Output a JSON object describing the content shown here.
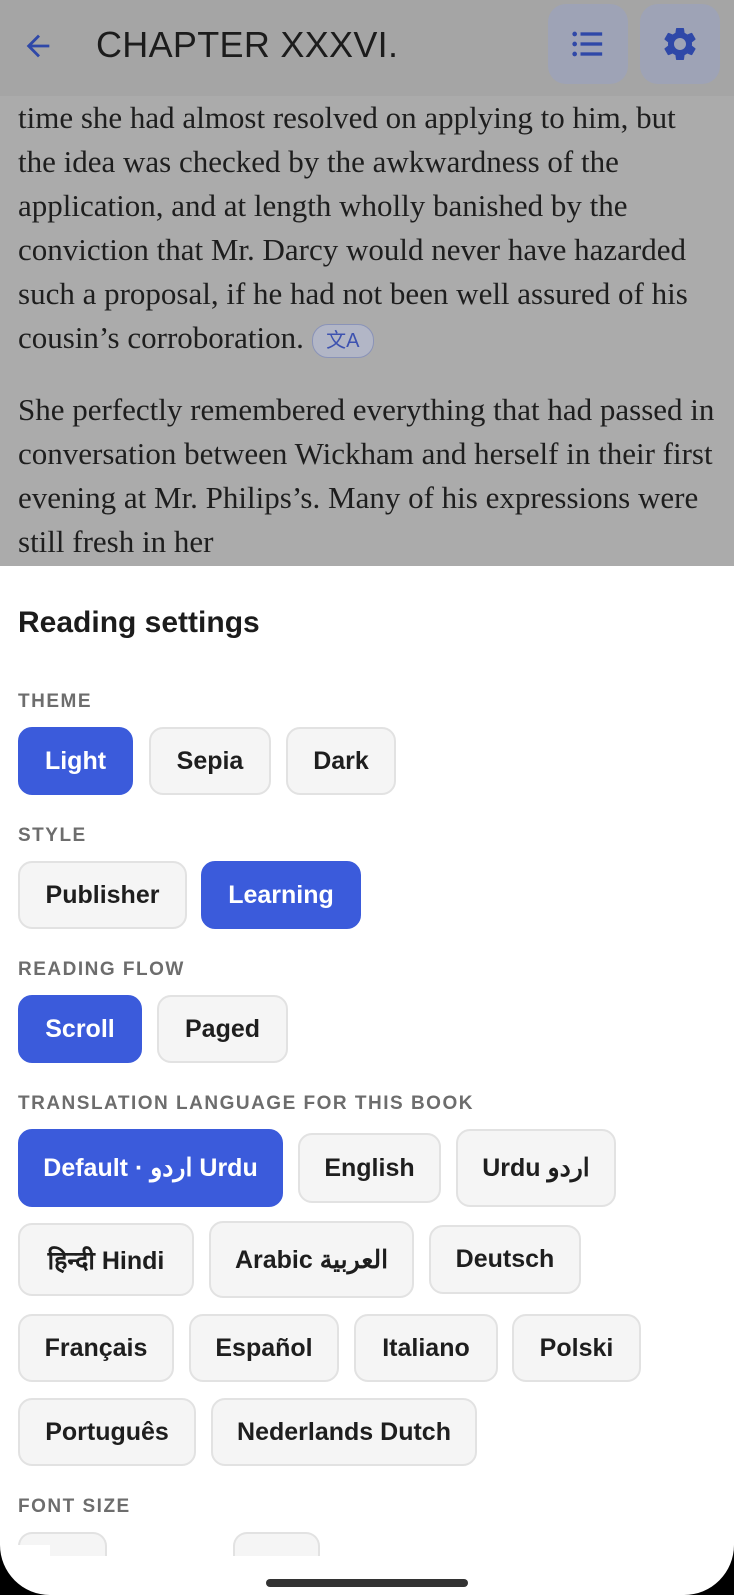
{
  "header": {
    "title": "CHAPTER XXXVI.",
    "back_icon": "arrow-left-icon",
    "toc_icon": "list-icon",
    "settings_icon": "gear-icon"
  },
  "reader": {
    "paragraph_1": "time she had almost resolved on applying to him, but the idea was checked by the awkwardness of the application, and at length wholly banished by the conviction that Mr. Darcy would never have hazarded such a proposal, if he had not been well assured of his cousin’s corroboration.",
    "translate_chip": "文A",
    "paragraph_2": "She perfectly remembered everything that had passed in conversation between Wickham and herself in their first evening at Mr. Philips’s. Many of his expressions were still fresh in her"
  },
  "settings": {
    "title": "Reading settings",
    "theme": {
      "label": "THEME",
      "options": [
        "Light",
        "Sepia",
        "Dark"
      ],
      "selected": "Light"
    },
    "style": {
      "label": "STYLE",
      "options": [
        "Publisher",
        "Learning"
      ],
      "selected": "Learning"
    },
    "flow": {
      "label": "READING FLOW",
      "options": [
        "Scroll",
        "Paged"
      ],
      "selected": "Scroll"
    },
    "translation": {
      "label": "TRANSLATION LANGUAGE FOR THIS BOOK",
      "options": [
        "Default · اردو Urdu",
        "English",
        "Urdu اردو",
        "हिन्दी Hindi",
        "Arabic العربية",
        "Deutsch",
        "Français",
        "Español",
        "Italiano",
        "Polski",
        "Português",
        "Nederlands Dutch"
      ],
      "selected": "Default · اردو Urdu"
    },
    "font_size": {
      "label": "FONT SIZE"
    }
  },
  "colors": {
    "accent": "#3b5bdb",
    "chip_bg": "#f5f5f5",
    "overlay": "#ababab"
  }
}
